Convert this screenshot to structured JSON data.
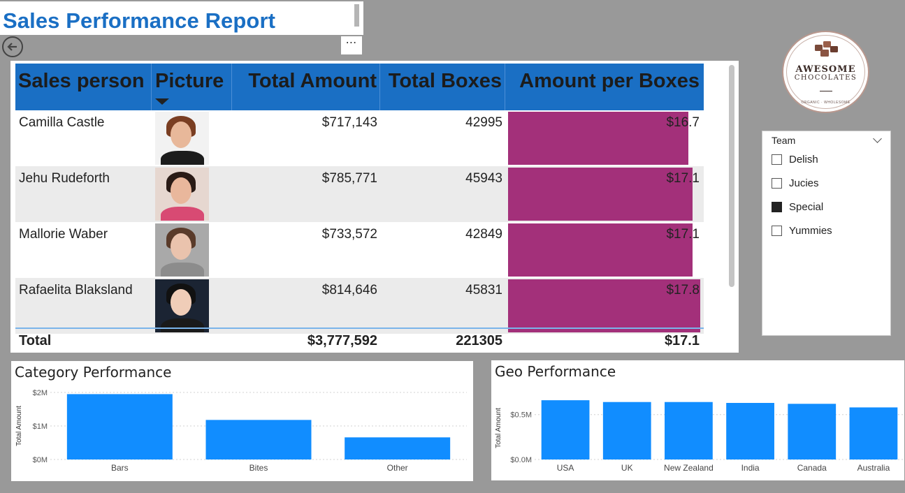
{
  "report": {
    "title": "Sales Performance Report",
    "more_label": "⋯"
  },
  "table": {
    "columns": [
      "Sales person",
      "Picture",
      "Total Amount",
      "Total Boxes",
      "Amount per Boxes"
    ],
    "rows": [
      {
        "name": "Camilla Castle",
        "amount": "$717,143",
        "boxes": "42995",
        "per_box": "$16.7",
        "per_box_value": 16.7,
        "photo": {
          "skin": "#e8b89a",
          "hair": "#7a3e22",
          "shirt": "#1c1c1c",
          "bg": "#f2f2f2"
        }
      },
      {
        "name": "Jehu Rudeforth",
        "amount": "$785,771",
        "boxes": "45943",
        "per_box": "$17.1",
        "per_box_value": 17.1,
        "photo": {
          "skin": "#e9b79c",
          "hair": "#2a1b16",
          "shirt": "#d84a73",
          "bg": "#e6d7d0"
        }
      },
      {
        "name": "Mallorie Waber",
        "amount": "$733,572",
        "boxes": "42849",
        "per_box": "$17.1",
        "per_box_value": 17.1,
        "photo": {
          "skin": "#eac3ad",
          "hair": "#5a3b2a",
          "shirt": "#8c8c8c",
          "bg": "#a9a9a9"
        }
      },
      {
        "name": "Rafaelita Blaksland",
        "amount": "$814,646",
        "boxes": "45831",
        "per_box": "$17.8",
        "per_box_value": 17.8,
        "photo": {
          "skin": "#f0cdb8",
          "hair": "#111111",
          "shirt": "#1a1a1a",
          "bg": "#1b2433"
        }
      }
    ],
    "total": {
      "label": "Total",
      "amount": "$3,777,592",
      "boxes": "221305",
      "per_box": "$17.1"
    },
    "bar_max": 17.9
  },
  "logo": {
    "line1": "AWESOME",
    "line2": "CHOCOLATES",
    "tagline": "ORGANIC · WHOLESOME"
  },
  "slicer": {
    "title": "Team",
    "items": [
      {
        "label": "Delish",
        "checked": false
      },
      {
        "label": "Jucies",
        "checked": false
      },
      {
        "label": "Special",
        "checked": true
      },
      {
        "label": "Yummies",
        "checked": false
      }
    ]
  },
  "colors": {
    "header_blue": "#1a6fc4",
    "bar_magenta": "#a3307a",
    "column_blue": "#118dff"
  },
  "chart_data": [
    {
      "type": "bar",
      "title": "Category Performance",
      "ylabel": "Total Amount",
      "categories": [
        "Bars",
        "Bites",
        "Other"
      ],
      "values": [
        1950000,
        1180000,
        660000
      ],
      "yticks": [
        0,
        1000000,
        2000000
      ],
      "ytick_labels": [
        "$0M",
        "$1M",
        "$2M"
      ],
      "ylim": [
        0,
        2000000
      ]
    },
    {
      "type": "bar",
      "title": "Geo Performance",
      "ylabel": "Total Amount",
      "categories": [
        "USA",
        "UK",
        "New Zealand",
        "India",
        "Canada",
        "Australia"
      ],
      "values": [
        0.66,
        0.64,
        0.64,
        0.63,
        0.62,
        0.58
      ],
      "yticks": [
        0,
        0.5
      ],
      "ytick_labels": [
        "$0.0M",
        "$0.5M"
      ],
      "ylim": [
        0,
        0.7
      ]
    }
  ]
}
